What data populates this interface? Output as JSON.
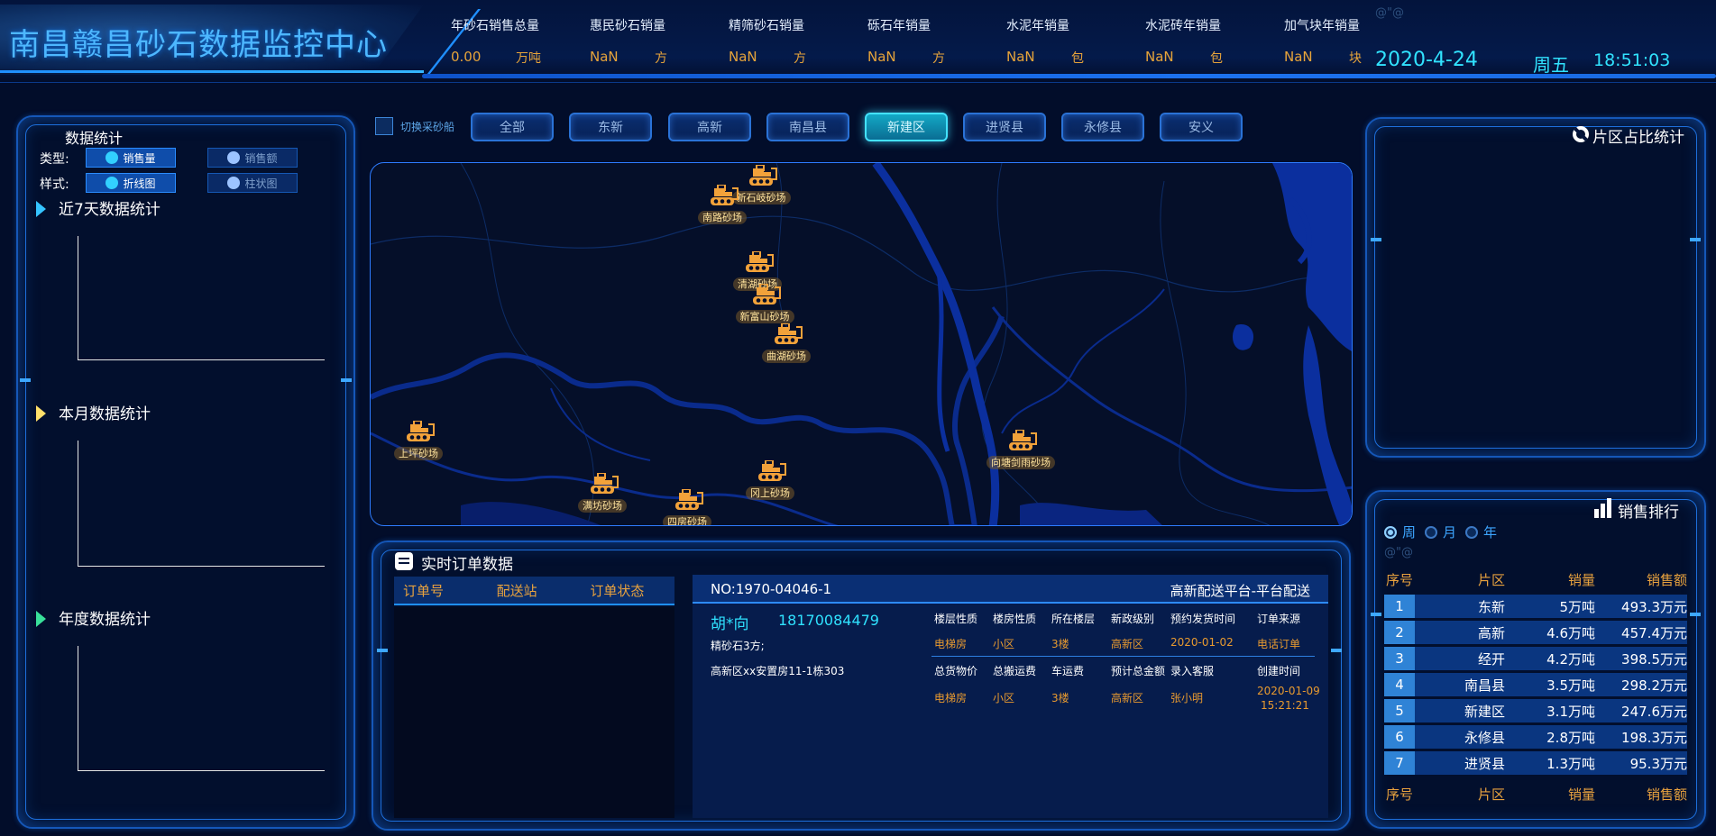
{
  "header": {
    "title": "南昌赣昌砂石数据监控中心",
    "stats": [
      {
        "label": "年砂石销售总量",
        "value": "0.00",
        "unit": "万吨"
      },
      {
        "label": "惠民砂石销量",
        "value": "NaN",
        "unit": "方"
      },
      {
        "label": "精筛砂石销量",
        "value": "NaN",
        "unit": "方"
      },
      {
        "label": "砾石年销量",
        "value": "NaN",
        "unit": "方"
      },
      {
        "label": "水泥年销量",
        "value": "NaN",
        "unit": "包"
      },
      {
        "label": "水泥砖年销量",
        "value": "NaN",
        "unit": "包"
      },
      {
        "label": "加气块年销量",
        "value": "NaN",
        "unit": "块"
      }
    ],
    "garbled": "@\"@",
    "date": "2020-4-24",
    "weekday": "周五",
    "time": "18:51:03"
  },
  "left": {
    "title": "数据统计",
    "type_label": "类型:",
    "style_label": "样式:",
    "type_options": [
      "销售量",
      "销售额"
    ],
    "style_options": [
      "折线图",
      "柱状图"
    ],
    "sections": [
      "近7天数据统计",
      "本月数据统计",
      "年度数据统计"
    ]
  },
  "center": {
    "switch_label": "切换采砂船",
    "regions": [
      "全部",
      "东新",
      "高新",
      "南昌县",
      "新建区",
      "进贤县",
      "永修县",
      "安义"
    ],
    "active_region": "新建区",
    "sites": [
      "新石岐砂场",
      "南路砂场",
      "清湖砂场",
      "新富山砂场",
      "曲湖砂场",
      "上坪砂场",
      "满坊砂场",
      "四房砂场",
      "冈上砂场",
      "向塘剑雨砂场"
    ]
  },
  "orders": {
    "title": "实时订单数据",
    "columns": [
      "订单号",
      "配送站",
      "订单状态"
    ],
    "detail": {
      "no": "NO:1970-04046-1",
      "platform": "高新配送平台-平台配送",
      "customer_name": "胡*向",
      "phone": "18170084479",
      "goods": "精砂石3方;",
      "address": "高新区xx安置房11-1栋303",
      "row1_labels": [
        "楼层性质",
        "楼房性质",
        "所在楼层",
        "新政级别",
        "预约发货时间",
        "订单来源"
      ],
      "row1_values": [
        "电梯房",
        "小区",
        "3楼",
        "高新区",
        "2020-01-02",
        "电话订单"
      ],
      "row2_labels": [
        "总货物价",
        "总搬运费",
        "车运费",
        "预计总金额",
        "录入客服",
        "创建时间"
      ],
      "row2_values": [
        "电梯房",
        "小区",
        "3楼",
        "高新区",
        "张小明",
        "2020-01-09",
        "15:21:21"
      ]
    }
  },
  "pie": {
    "title": "片区占比统计"
  },
  "ranking": {
    "title": "销售排行",
    "periods": [
      "周",
      "月",
      "年"
    ],
    "selected_period": "周",
    "garbled": "@\"@",
    "headers": [
      "序号",
      "片区",
      "销量",
      "销售额"
    ],
    "rows": [
      [
        "1",
        "东新",
        "5万吨",
        "493.3万元"
      ],
      [
        "2",
        "高新",
        "4.6万吨",
        "457.4万元"
      ],
      [
        "3",
        "经开",
        "4.2万吨",
        "398.5万元"
      ],
      [
        "4",
        "南昌县",
        "3.5万吨",
        "298.2万元"
      ],
      [
        "5",
        "新建区",
        "3.1万吨",
        "247.6万元"
      ],
      [
        "6",
        "永修县",
        "2.8万吨",
        "198.3万元"
      ],
      [
        "7",
        "进贤县",
        "1.3万吨",
        "95.3万元"
      ]
    ]
  },
  "colors": {
    "background": "#020d2a",
    "accent": "#1f8fff",
    "cyan": "#31e3ff",
    "orange": "#e8a23e"
  }
}
